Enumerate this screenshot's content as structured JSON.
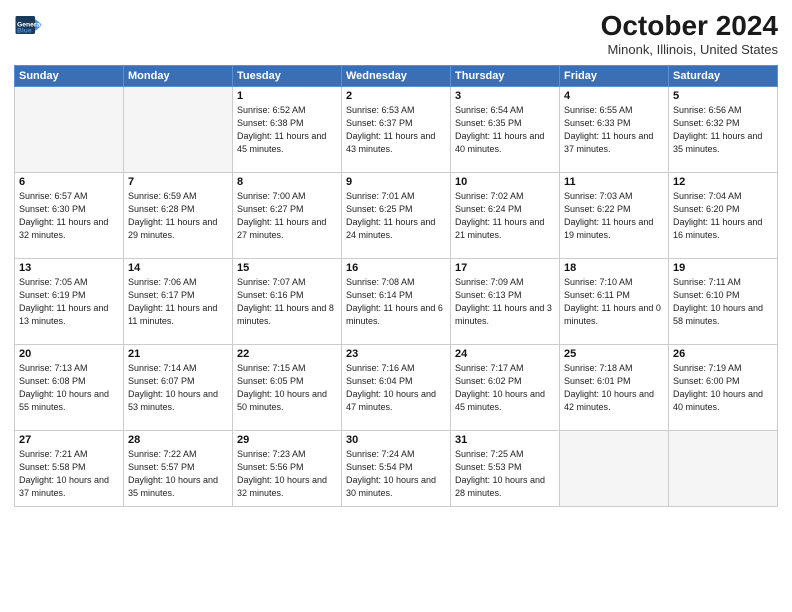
{
  "header": {
    "logo_line1": "General",
    "logo_line2": "Blue",
    "month_year": "October 2024",
    "location": "Minonk, Illinois, United States"
  },
  "weekdays": [
    "Sunday",
    "Monday",
    "Tuesday",
    "Wednesday",
    "Thursday",
    "Friday",
    "Saturday"
  ],
  "weeks": [
    [
      {
        "day": "",
        "empty": true
      },
      {
        "day": "",
        "empty": true
      },
      {
        "day": "1",
        "sunrise": "6:52 AM",
        "sunset": "6:38 PM",
        "daylight": "11 hours and 45 minutes."
      },
      {
        "day": "2",
        "sunrise": "6:53 AM",
        "sunset": "6:37 PM",
        "daylight": "11 hours and 43 minutes."
      },
      {
        "day": "3",
        "sunrise": "6:54 AM",
        "sunset": "6:35 PM",
        "daylight": "11 hours and 40 minutes."
      },
      {
        "day": "4",
        "sunrise": "6:55 AM",
        "sunset": "6:33 PM",
        "daylight": "11 hours and 37 minutes."
      },
      {
        "day": "5",
        "sunrise": "6:56 AM",
        "sunset": "6:32 PM",
        "daylight": "11 hours and 35 minutes."
      }
    ],
    [
      {
        "day": "6",
        "sunrise": "6:57 AM",
        "sunset": "6:30 PM",
        "daylight": "11 hours and 32 minutes."
      },
      {
        "day": "7",
        "sunrise": "6:59 AM",
        "sunset": "6:28 PM",
        "daylight": "11 hours and 29 minutes."
      },
      {
        "day": "8",
        "sunrise": "7:00 AM",
        "sunset": "6:27 PM",
        "daylight": "11 hours and 27 minutes."
      },
      {
        "day": "9",
        "sunrise": "7:01 AM",
        "sunset": "6:25 PM",
        "daylight": "11 hours and 24 minutes."
      },
      {
        "day": "10",
        "sunrise": "7:02 AM",
        "sunset": "6:24 PM",
        "daylight": "11 hours and 21 minutes."
      },
      {
        "day": "11",
        "sunrise": "7:03 AM",
        "sunset": "6:22 PM",
        "daylight": "11 hours and 19 minutes."
      },
      {
        "day": "12",
        "sunrise": "7:04 AM",
        "sunset": "6:20 PM",
        "daylight": "11 hours and 16 minutes."
      }
    ],
    [
      {
        "day": "13",
        "sunrise": "7:05 AM",
        "sunset": "6:19 PM",
        "daylight": "11 hours and 13 minutes."
      },
      {
        "day": "14",
        "sunrise": "7:06 AM",
        "sunset": "6:17 PM",
        "daylight": "11 hours and 11 minutes."
      },
      {
        "day": "15",
        "sunrise": "7:07 AM",
        "sunset": "6:16 PM",
        "daylight": "11 hours and 8 minutes."
      },
      {
        "day": "16",
        "sunrise": "7:08 AM",
        "sunset": "6:14 PM",
        "daylight": "11 hours and 6 minutes."
      },
      {
        "day": "17",
        "sunrise": "7:09 AM",
        "sunset": "6:13 PM",
        "daylight": "11 hours and 3 minutes."
      },
      {
        "day": "18",
        "sunrise": "7:10 AM",
        "sunset": "6:11 PM",
        "daylight": "11 hours and 0 minutes."
      },
      {
        "day": "19",
        "sunrise": "7:11 AM",
        "sunset": "6:10 PM",
        "daylight": "10 hours and 58 minutes."
      }
    ],
    [
      {
        "day": "20",
        "sunrise": "7:13 AM",
        "sunset": "6:08 PM",
        "daylight": "10 hours and 55 minutes."
      },
      {
        "day": "21",
        "sunrise": "7:14 AM",
        "sunset": "6:07 PM",
        "daylight": "10 hours and 53 minutes."
      },
      {
        "day": "22",
        "sunrise": "7:15 AM",
        "sunset": "6:05 PM",
        "daylight": "10 hours and 50 minutes."
      },
      {
        "day": "23",
        "sunrise": "7:16 AM",
        "sunset": "6:04 PM",
        "daylight": "10 hours and 47 minutes."
      },
      {
        "day": "24",
        "sunrise": "7:17 AM",
        "sunset": "6:02 PM",
        "daylight": "10 hours and 45 minutes."
      },
      {
        "day": "25",
        "sunrise": "7:18 AM",
        "sunset": "6:01 PM",
        "daylight": "10 hours and 42 minutes."
      },
      {
        "day": "26",
        "sunrise": "7:19 AM",
        "sunset": "6:00 PM",
        "daylight": "10 hours and 40 minutes."
      }
    ],
    [
      {
        "day": "27",
        "sunrise": "7:21 AM",
        "sunset": "5:58 PM",
        "daylight": "10 hours and 37 minutes."
      },
      {
        "day": "28",
        "sunrise": "7:22 AM",
        "sunset": "5:57 PM",
        "daylight": "10 hours and 35 minutes."
      },
      {
        "day": "29",
        "sunrise": "7:23 AM",
        "sunset": "5:56 PM",
        "daylight": "10 hours and 32 minutes."
      },
      {
        "day": "30",
        "sunrise": "7:24 AM",
        "sunset": "5:54 PM",
        "daylight": "10 hours and 30 minutes."
      },
      {
        "day": "31",
        "sunrise": "7:25 AM",
        "sunset": "5:53 PM",
        "daylight": "10 hours and 28 minutes."
      },
      {
        "day": "",
        "empty": true
      },
      {
        "day": "",
        "empty": true
      }
    ]
  ]
}
